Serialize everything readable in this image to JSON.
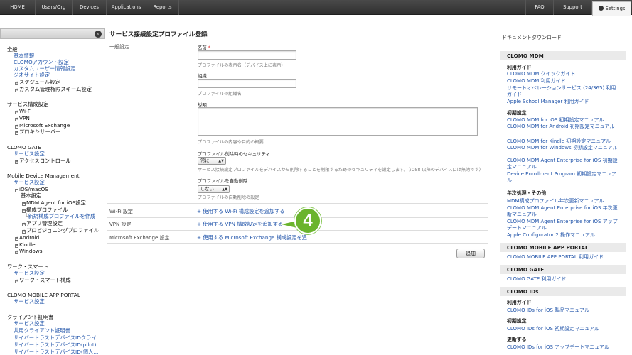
{
  "topnav": {
    "items": [
      "HOME",
      "Users/Org",
      "Devices",
      "Applications",
      "Reports"
    ],
    "faq": "FAQ",
    "support": "Support",
    "settings": "Settings"
  },
  "sidebar": {
    "collapse_icon": "chevron-left-icon",
    "general": {
      "title": "全般",
      "items": [
        "基本情報",
        "CLOMOアカウント設定",
        "カスタムユーザー情報設定",
        "ジオサイト設定",
        "スケジュール設定",
        "カスタム管理権限スキーム設定"
      ]
    },
    "service": {
      "title": "サービス構成設定",
      "items": [
        "Wi-Fi",
        "VPN",
        "Microsoft Exchange",
        "プロキシサーバー"
      ]
    },
    "gate": {
      "title": "CLOMO GATE",
      "items": [
        "サービス設定",
        "アクセスコントロール"
      ]
    },
    "mdm": {
      "title": "Mobile Device Management",
      "items": [
        "サービス設定",
        "iOS/macOS",
        "基本設定",
        "MDM Agent for iOS設定",
        "構成プロファイル",
        "新規構成プロファイルを作成",
        "アプリ管理設定",
        "プロビジョニングプロファイル",
        "Android",
        "Kindle",
        "Windows"
      ]
    },
    "workstyle": {
      "title": "ワーク・スマート",
      "items": [
        "サービス設定",
        "ワーク・スマート構成"
      ]
    },
    "portal": {
      "title": "CLOMO MOBILE APP PORTAL",
      "items": [
        "サービス設定"
      ]
    },
    "cert": {
      "title": "クライアント証明書",
      "items": [
        "サービス設定",
        "共用クライアント証明書",
        "サイバートラストデバイスIDクライ…",
        "サイバートラストデバイスID(pilot)…",
        "サイバートラストデバイスID(個人…"
      ]
    }
  },
  "main": {
    "title": "サービス接続設定プロファイル登録",
    "general_label": "一般設定",
    "name_label": "名前",
    "required_mark": "*",
    "name_value": "",
    "name_hint": "プロファイルの表示名（デバイス上に表示）",
    "org_label": "組織",
    "org_value": "",
    "org_hint": "プロファイルの組織名",
    "desc_label": "説明",
    "desc_value": "",
    "desc_hint": "プロファイルの内容や目的の概要",
    "security_label": "プロファイル削除時のセキュリティ",
    "security_value": "常に",
    "security_hint": "サービス接続設定プロファイルをデバイスから削除することを制限するためのセキュリティを設定します。（iOS8 以降のデバイスには無効です）",
    "autodelete_label": "プロファイルを自動削除",
    "autodelete_value": "しない",
    "autodelete_hint": "プロファイルの自動削除の設定",
    "wifi_label": "Wi-Fi 設定",
    "wifi_link": "+ 使用する Wi-Fi 構成設定を追加する",
    "vpn_label": "VPN 設定",
    "vpn_link": "+ 使用する VPN 構成設定を追加する",
    "exchange_label": "Microsoft Exchange 設定",
    "exchange_link": "+ 使用する Microsoft Exchange 構成設定を追",
    "add_button": "追加",
    "step_number": "4",
    "step_color": "#6ab42d"
  },
  "right": {
    "title": "ドキュメントダウンロード",
    "mdm_band": "CLOMO MDM",
    "guide_sub": "利用ガイド",
    "guide_links": [
      "CLOMO MDM クイックガイド",
      "CLOMO MDM 利用ガイド",
      "リモートオペレーションサービス (24/365) 利用ガイド",
      "Apple School Manager 利用ガイド"
    ],
    "init_sub": "初期設定",
    "init_links": [
      "CLOMO MDM for iOS 初期設定マニュアル",
      "CLOMO MDM for Android 初期設定マニュアル",
      "CLOMO MDM for Kindle 初期設定マニュアル",
      "CLOMO MDM for Windows 初期設定マニュアル",
      "CLOMO MDM Agent Enterprise for iOS 初期設定マニュアル",
      "Device Enrollment Program 初期設定マニュアル"
    ],
    "annual_sub": "年次処理・その他",
    "annual_links": [
      "MDM構成プロファイル年次更新マニュアル",
      "CLOMO MDM Agent Enterprise for iOS 年次更新マニュアル",
      "CLOMO MDM Agent Enterprise for iOS アップデートマニュアル",
      "Apple Configurator 2 操作マニュアル"
    ],
    "portal_band": "CLOMO MOBILE APP PORTAL",
    "portal_links": [
      "CLOMO MOBILE APP PORTAL 利用ガイド"
    ],
    "gate_band": "CLOMO GATE",
    "gate_links": [
      "CLOMO GATE 利用ガイド"
    ],
    "ids_band": "CLOMO IDs",
    "ids_guide_sub": "利用ガイド",
    "ids_guide_links": [
      "CLOMO IDs for iOS 製品マニュアル"
    ],
    "ids_init_sub": "初期設定",
    "ids_init_links": [
      "CLOMO IDs for iOS 初期設定マニュアル"
    ],
    "ids_update_sub": "更新する",
    "ids_update_links": [
      "CLOMO IDs for iOS アップデートマニュアル"
    ]
  }
}
